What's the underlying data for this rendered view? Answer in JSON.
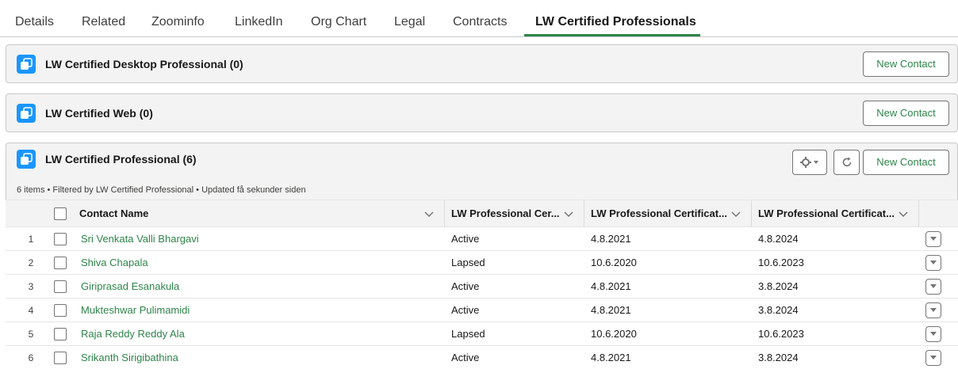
{
  "tabs": [
    {
      "label": "Details"
    },
    {
      "label": "Related"
    },
    {
      "label": "Zoominfo"
    },
    {
      "label": "LinkedIn"
    },
    {
      "label": "Org Chart"
    },
    {
      "label": "Legal"
    },
    {
      "label": "Contracts"
    },
    {
      "label": "LW Certified Professionals",
      "active": true
    }
  ],
  "cards": [
    {
      "title": "LW Certified Desktop Professional (0)",
      "button": "New Contact"
    },
    {
      "title": "LW Certified Web (0)",
      "button": "New Contact"
    },
    {
      "title": "LW Certified Professional (6)",
      "button": "New Contact",
      "subtitle": "6 items • Filtered by LW Certified Professional • Updated få sekunder siden"
    }
  ],
  "icons": {
    "list_icon": "related-list-icon",
    "settings": "gear-icon",
    "refresh": "refresh-icon",
    "row_menu": "chevron-down-icon"
  },
  "colors": {
    "accent": "#2e844a",
    "icon_bg": "#1b96ff"
  },
  "table": {
    "columns": [
      {
        "label": "Contact Name"
      },
      {
        "label": "LW Professional Cer..."
      },
      {
        "label": "LW Professional Certificat..."
      },
      {
        "label": "LW Professional Certificat..."
      }
    ],
    "rows": [
      {
        "num": "1",
        "name": "Sri Venkata Valli Bhargavi",
        "status": "Active",
        "start": "4.8.2021",
        "end": "4.8.2024"
      },
      {
        "num": "2",
        "name": "Shiva Chapala",
        "status": "Lapsed",
        "start": "10.6.2020",
        "end": "10.6.2023"
      },
      {
        "num": "3",
        "name": "Giriprasad Esanakula",
        "status": "Active",
        "start": "4.8.2021",
        "end": "3.8.2024"
      },
      {
        "num": "4",
        "name": "Mukteshwar Pulimamidi",
        "status": "Active",
        "start": "4.8.2021",
        "end": "3.8.2024"
      },
      {
        "num": "5",
        "name": "Raja Reddy Reddy Ala",
        "status": "Lapsed",
        "start": "10.6.2020",
        "end": "10.6.2023"
      },
      {
        "num": "6",
        "name": "Srikanth Sirigibathina",
        "status": "Active",
        "start": "4.8.2021",
        "end": "3.8.2024"
      }
    ]
  }
}
